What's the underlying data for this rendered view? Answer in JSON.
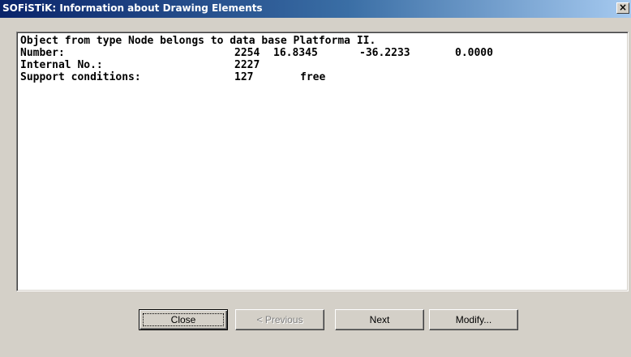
{
  "window": {
    "title": "SOFiSTiK: Information about Drawing Elements",
    "close_glyph": "×"
  },
  "info": {
    "line1": "Object from type Node belongs to data base Platforma II.",
    "number": {
      "label": "Number:",
      "id": "2254",
      "x": "16.8345",
      "y": "-36.2233",
      "z": "0.0000"
    },
    "internal": {
      "label": "Internal No.:",
      "value": "2227"
    },
    "support": {
      "label": "Support conditions:",
      "code": "127",
      "text": "free"
    }
  },
  "buttons": {
    "close": "Close",
    "previous": "< Previous",
    "next": "Next",
    "modify": "Modify..."
  }
}
